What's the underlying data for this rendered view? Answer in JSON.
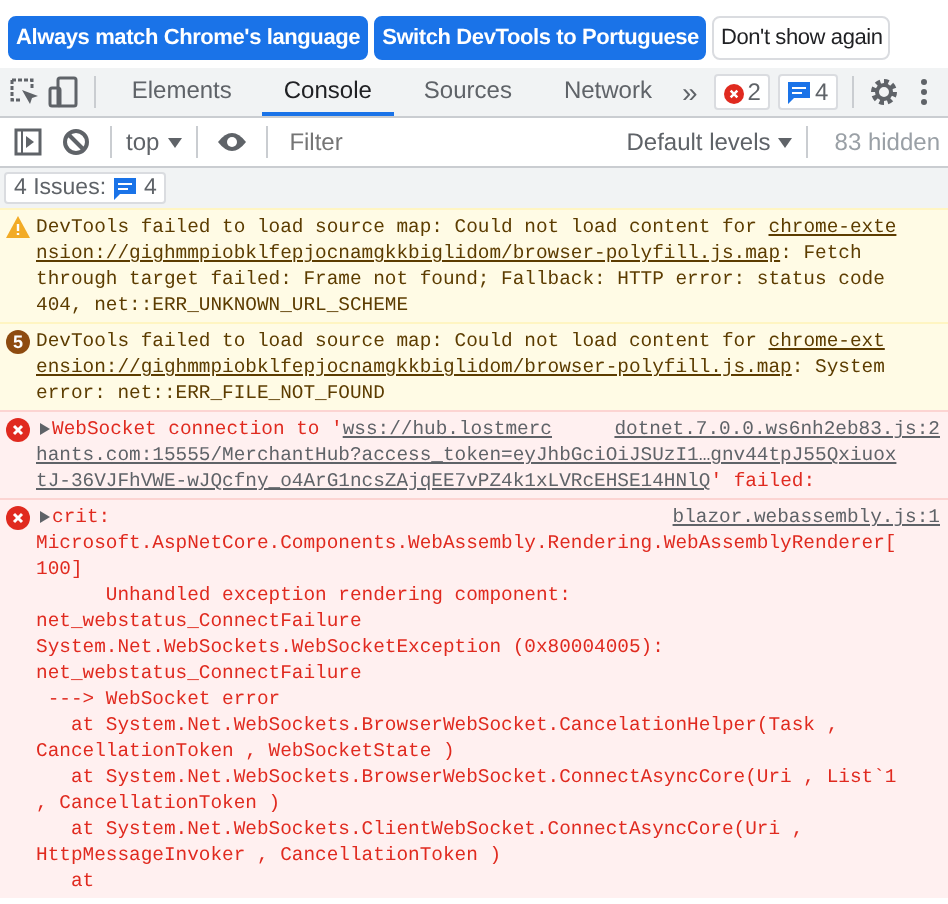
{
  "infobar": {
    "buttons": [
      {
        "label": "Always match Chrome's language",
        "kind": "primary"
      },
      {
        "label": "Switch DevTools to Portuguese",
        "kind": "primary"
      },
      {
        "label": "Don't show again",
        "kind": "plain"
      }
    ]
  },
  "tabs": [
    {
      "label": "Elements",
      "selected": false
    },
    {
      "label": "Console",
      "selected": true
    },
    {
      "label": "Sources",
      "selected": false
    },
    {
      "label": "Network",
      "selected": false
    }
  ],
  "overflow": "»",
  "counters": {
    "errors": "2",
    "messages": "4"
  },
  "console_toolbar": {
    "context": "top",
    "filter_placeholder": "Filter",
    "levels": "Default levels",
    "hidden": "83 hidden"
  },
  "issues": {
    "label": "4 Issues:",
    "count": "4"
  },
  "messages": [
    {
      "kind": "warning",
      "expandable": false,
      "lines": [
        [
          {
            "text": "DevTools failed to load source map: Could not load content for ",
            "kind": "plain"
          },
          {
            "text": "chrome-exte",
            "kind": "link"
          }
        ],
        [
          {
            "text": "nsion://gighmmpiobklfepjocnamgkkbiglidom/browser-polyfill.js.map",
            "kind": "link"
          },
          {
            "text": ": Fetch",
            "kind": "plain"
          }
        ],
        [
          {
            "text": "through target failed: Frame not found; Fallback: HTTP error: status code",
            "kind": "plain"
          }
        ],
        [
          {
            "text": "404, net::ERR_UNKNOWN_URL_SCHEME",
            "kind": "plain"
          }
        ]
      ]
    },
    {
      "kind": "warning",
      "count": "5",
      "expandable": false,
      "lines": [
        [
          {
            "text": "DevTools failed to load source map: Could not load content for ",
            "kind": "plain"
          },
          {
            "text": "chrome-ext",
            "kind": "link"
          }
        ],
        [
          {
            "text": "ension://gighmmpiobklfepjocnamgkkbiglidom/browser-polyfill.js.map",
            "kind": "link"
          },
          {
            "text": ": System",
            "kind": "plain"
          }
        ],
        [
          {
            "text": "error: net::ERR_FILE_NOT_FOUND",
            "kind": "plain"
          }
        ]
      ]
    },
    {
      "kind": "error",
      "expandable": true,
      "source": "dotnet.7.0.0.ws6nh2eb83.js:2",
      "lines": [
        [
          {
            "text": "WebSocket connection to '",
            "kind": "plain"
          },
          {
            "text": "wss://hub.lostmerc",
            "kind": "link"
          }
        ],
        [
          {
            "text": "hants.com:15555/MerchantHub?access_token=eyJhbGciOiJSUzI1…gnv44tpJ55Qxiuox",
            "kind": "link"
          }
        ],
        [
          {
            "text": "tJ-36VJFhVWE-wJQcfny_o4ArG1ncsZAjqEE7vPZ4k1xLVRcEHSE14HNlQ",
            "kind": "link"
          },
          {
            "text": "' failed:",
            "kind": "plain"
          }
        ]
      ]
    },
    {
      "kind": "error",
      "expandable": true,
      "source": "blazor.webassembly.js:1",
      "lines": [
        [
          {
            "text": "crit:",
            "kind": "plain"
          }
        ],
        [
          {
            "text": "Microsoft.AspNetCore.Components.WebAssembly.Rendering.WebAssemblyRenderer[",
            "kind": "plain"
          }
        ],
        [
          {
            "text": "100]",
            "kind": "plain"
          }
        ],
        [
          {
            "text": "      Unhandled exception rendering component:",
            "kind": "plain"
          }
        ],
        [
          {
            "text": "net_webstatus_ConnectFailure",
            "kind": "plain"
          }
        ],
        [
          {
            "text": "System.Net.WebSockets.WebSocketException (0x80004005):",
            "kind": "plain"
          }
        ],
        [
          {
            "text": "net_webstatus_ConnectFailure",
            "kind": "plain"
          }
        ],
        [
          {
            "text": " ---> WebSocket error",
            "kind": "plain"
          }
        ],
        [
          {
            "text": "   at System.Net.WebSockets.BrowserWebSocket.CancelationHelper(Task ,",
            "kind": "plain"
          }
        ],
        [
          {
            "text": "CancellationToken , WebSocketState )",
            "kind": "plain"
          }
        ],
        [
          {
            "text": "   at System.Net.WebSockets.BrowserWebSocket.ConnectAsyncCore(Uri , List`1",
            "kind": "plain"
          }
        ],
        [
          {
            "text": ", CancellationToken )",
            "kind": "plain"
          }
        ],
        [
          {
            "text": "   at System.Net.WebSockets.ClientWebSocket.ConnectAsyncCore(Uri ,",
            "kind": "plain"
          }
        ],
        [
          {
            "text": "HttpMessageInvoker , CancellationToken )",
            "kind": "plain"
          }
        ],
        [
          {
            "text": "   at",
            "kind": "plain"
          }
        ]
      ]
    }
  ]
}
